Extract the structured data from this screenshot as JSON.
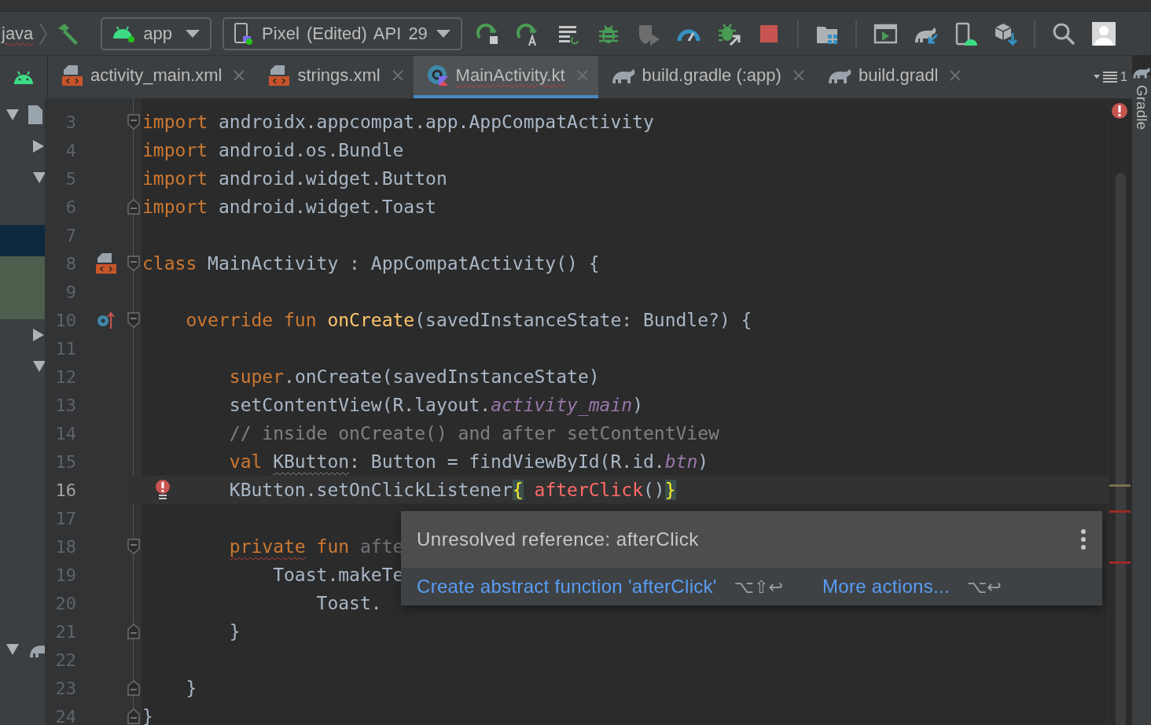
{
  "toolbar": {
    "breadcrumb": "java",
    "configuration": "app",
    "device": "Pixel (Edited) API 29"
  },
  "tabs": [
    {
      "label": "activity_main.xml",
      "kind": "xml",
      "selected": false,
      "error": false
    },
    {
      "label": "strings.xml",
      "kind": "xml",
      "selected": false,
      "error": false
    },
    {
      "label": "MainActivity.kt",
      "kind": "kotlin",
      "selected": true,
      "error": true
    },
    {
      "label": "build.gradle (:app)",
      "kind": "gradle",
      "selected": false,
      "error": false
    },
    {
      "label": "build.gradl",
      "kind": "gradle",
      "selected": false,
      "error": false
    }
  ],
  "tab_overflow": {
    "count": "1"
  },
  "project_tree": [
    {
      "expanded": true,
      "kind": "file",
      "children": [
        {
          "expanded": false
        },
        {
          "expanded": true,
          "children": [
            {
              "selected": false,
              "highlighted": false
            },
            {
              "selected": true,
              "highlighted": false
            },
            {
              "selected": false,
              "highlighted": true
            },
            {
              "selected": false,
              "highlighted": true
            }
          ]
        },
        {
          "expanded": false
        },
        {
          "expanded": true,
          "children": [
            {
              "selected": false,
              "highlighted": false
            },
            {
              "selected": false,
              "highlighted": false
            },
            {
              "selected": false,
              "highlighted": false
            },
            {
              "selected": false,
              "highlighted": false
            },
            {
              "selected": false,
              "highlighted": false
            },
            {
              "selected": false,
              "highlighted": false
            },
            {
              "selected": false,
              "highlighted": false
            },
            {
              "selected": false,
              "highlighted": false
            }
          ]
        }
      ]
    },
    {
      "expanded": true,
      "kind": "gradle"
    }
  ],
  "editor": {
    "lines": [
      {
        "number": "3",
        "fold": {
          "kind": "start"
        },
        "current": false,
        "tokens": [
          {
            "kind": "keyword",
            "text": "import"
          },
          {
            "kind": "plain",
            "text": " androidx.appcompat.app.AppCompatActivity"
          }
        ]
      },
      {
        "number": "4",
        "current": false,
        "tokens": [
          {
            "kind": "keyword",
            "text": "import"
          },
          {
            "kind": "plain",
            "text": " android.os.Bundle"
          }
        ]
      },
      {
        "number": "5",
        "current": false,
        "tokens": [
          {
            "kind": "keyword",
            "text": "import"
          },
          {
            "kind": "plain",
            "text": " android.widget.Button"
          }
        ]
      },
      {
        "number": "6",
        "fold": {
          "kind": "end"
        },
        "current": false,
        "tokens": [
          {
            "kind": "keyword",
            "text": "import"
          },
          {
            "kind": "plain",
            "text": " android.widget.Toast"
          }
        ]
      },
      {
        "number": "7",
        "current": false
      },
      {
        "number": "8",
        "fold": {
          "kind": "start"
        },
        "gutter_icon": {
          "kind": "layout"
        },
        "current": false,
        "tokens": [
          {
            "kind": "keyword",
            "text": "class"
          },
          {
            "kind": "plain",
            "text": " MainActivity : AppCompatActivity() {"
          }
        ]
      },
      {
        "number": "9",
        "current": false
      },
      {
        "number": "10",
        "fold": {
          "kind": "start"
        },
        "gutter_icon": {
          "kind": "override"
        },
        "current": false,
        "tokens": [
          {
            "kind": "keyword",
            "text": "    override fun "
          },
          {
            "kind": "declaration",
            "text": "onCreate"
          },
          {
            "kind": "plain",
            "text": "(savedInstanceState: Bundle?) {"
          }
        ]
      },
      {
        "number": "11",
        "current": false
      },
      {
        "number": "12",
        "current": false,
        "tokens": [
          {
            "kind": "keyword",
            "text": "        super"
          },
          {
            "kind": "plain",
            "text": ".onCreate(savedInstanceState)"
          }
        ]
      },
      {
        "number": "13",
        "current": false,
        "tokens": [
          {
            "kind": "plain",
            "text": "        setContentView(R.layout."
          },
          {
            "kind": "field",
            "text": "activity_main"
          },
          {
            "kind": "plain",
            "text": ")"
          }
        ]
      },
      {
        "number": "14",
        "current": false,
        "tokens": [
          {
            "kind": "comment",
            "text": "        // inside onCreate() and after setContentView"
          }
        ]
      },
      {
        "number": "15",
        "current": false,
        "tokens": [
          {
            "kind": "keyword",
            "text": "        val "
          },
          {
            "kind": "plain",
            "text": "KButton",
            "warning_underline": true
          },
          {
            "kind": "plain",
            "text": ": Button = findViewById(R.id."
          },
          {
            "kind": "field",
            "text": "btn"
          },
          {
            "kind": "plain",
            "text": ")"
          }
        ]
      },
      {
        "number": "16",
        "gutter_icon": {
          "kind": "error-bulb"
        },
        "current": true,
        "tokens": [
          {
            "kind": "plain",
            "text": "        KButton.setOnClickListener"
          },
          {
            "kind": "brace",
            "text": "{"
          },
          {
            "kind": "error",
            "text": " afterClick"
          },
          {
            "kind": "plain",
            "text": "()"
          },
          {
            "kind": "brace",
            "text": "}"
          }
        ]
      },
      {
        "number": "17",
        "current": false
      },
      {
        "number": "18",
        "fold": {
          "kind": "start"
        },
        "current": false,
        "tokens": [
          {
            "kind": "keyword",
            "text": "        private",
            "error_underline": true
          },
          {
            "kind": "keyword",
            "text": " fun "
          },
          {
            "kind": "unused",
            "text": "afte"
          }
        ]
      },
      {
        "number": "19",
        "current": false,
        "tokens": [
          {
            "kind": "plain",
            "text": "            Toast.makeTe"
          }
        ]
      },
      {
        "number": "20",
        "current": false,
        "tokens": [
          {
            "kind": "plain",
            "text": "                Toast."
          }
        ]
      },
      {
        "number": "21",
        "fold": {
          "kind": "end"
        },
        "current": false,
        "tokens": [
          {
            "kind": "plain",
            "text": "        }"
          }
        ]
      },
      {
        "number": "22",
        "current": false
      },
      {
        "number": "23",
        "fold": {
          "kind": "end"
        },
        "current": false,
        "tokens": [
          {
            "kind": "plain",
            "text": "    }"
          }
        ]
      },
      {
        "number": "24",
        "fold": {
          "kind": "end"
        },
        "current": false,
        "tokens": [
          {
            "kind": "plain",
            "text": "}"
          }
        ]
      }
    ]
  },
  "popup": {
    "message": "Unresolved reference: afterClick",
    "actions": [
      {
        "label": "Create abstract function 'afterClick'",
        "shortcut": "⌥⇧↩"
      },
      {
        "label": "More actions...",
        "shortcut": "⌥↩"
      }
    ]
  },
  "side_strip": {
    "label": "Gradle"
  }
}
